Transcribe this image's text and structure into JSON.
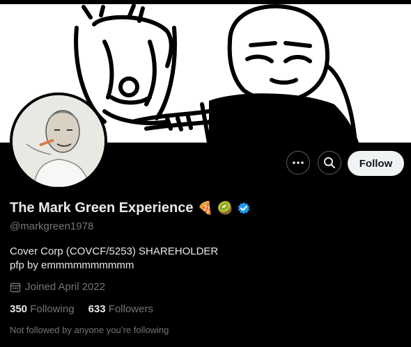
{
  "profile": {
    "display_name": "The Mark Green Experience",
    "emoji": [
      "🍕",
      "🥝"
    ],
    "verified_icon": "verified-badge-icon",
    "handle": "@markgreen1978",
    "bio_line1": "Cover Corp (COVCF/5253) SHAREHOLDER",
    "bio_line2": "pfp by emmmmmmmmmm",
    "joined": "Joined April 2022",
    "following_count": "350",
    "following_label": "Following",
    "followers_count": "633",
    "followers_label": "Followers",
    "not_followed": "Not followed by anyone you’re following"
  },
  "actions": {
    "more_icon": "more-icon",
    "search_icon": "search-icon",
    "follow_label": "Follow"
  },
  "colors": {
    "background": "#000000",
    "text_primary": "#e7e9ea",
    "text_secondary": "#71767b",
    "verified": "#1d9bf0",
    "follow_bg": "#eff3f4"
  }
}
